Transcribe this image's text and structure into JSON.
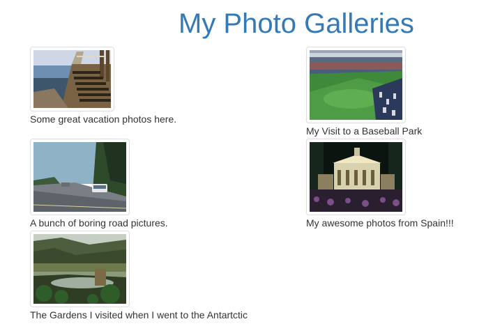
{
  "page": {
    "title": "My Photo Galleries"
  },
  "galleries": [
    {
      "caption": "Some great vacation photos here.",
      "image": "seaside-stone-stairs-photo"
    },
    {
      "caption": "My Visit to a Baseball Park",
      "image": "baseball-stadium-photo"
    },
    {
      "caption": "A bunch of boring road pictures.",
      "image": "highway-road-photo"
    },
    {
      "caption": "My awesome photos from Spain!!!",
      "image": "illuminated-theater-night-photo"
    },
    {
      "caption": "The Gardens I visited when I went to the Antartctic",
      "image": "garden-pond-photo"
    }
  ],
  "colors": {
    "title": "#337ab7",
    "text": "#333333",
    "thumbnail_border": "#dddddd"
  }
}
